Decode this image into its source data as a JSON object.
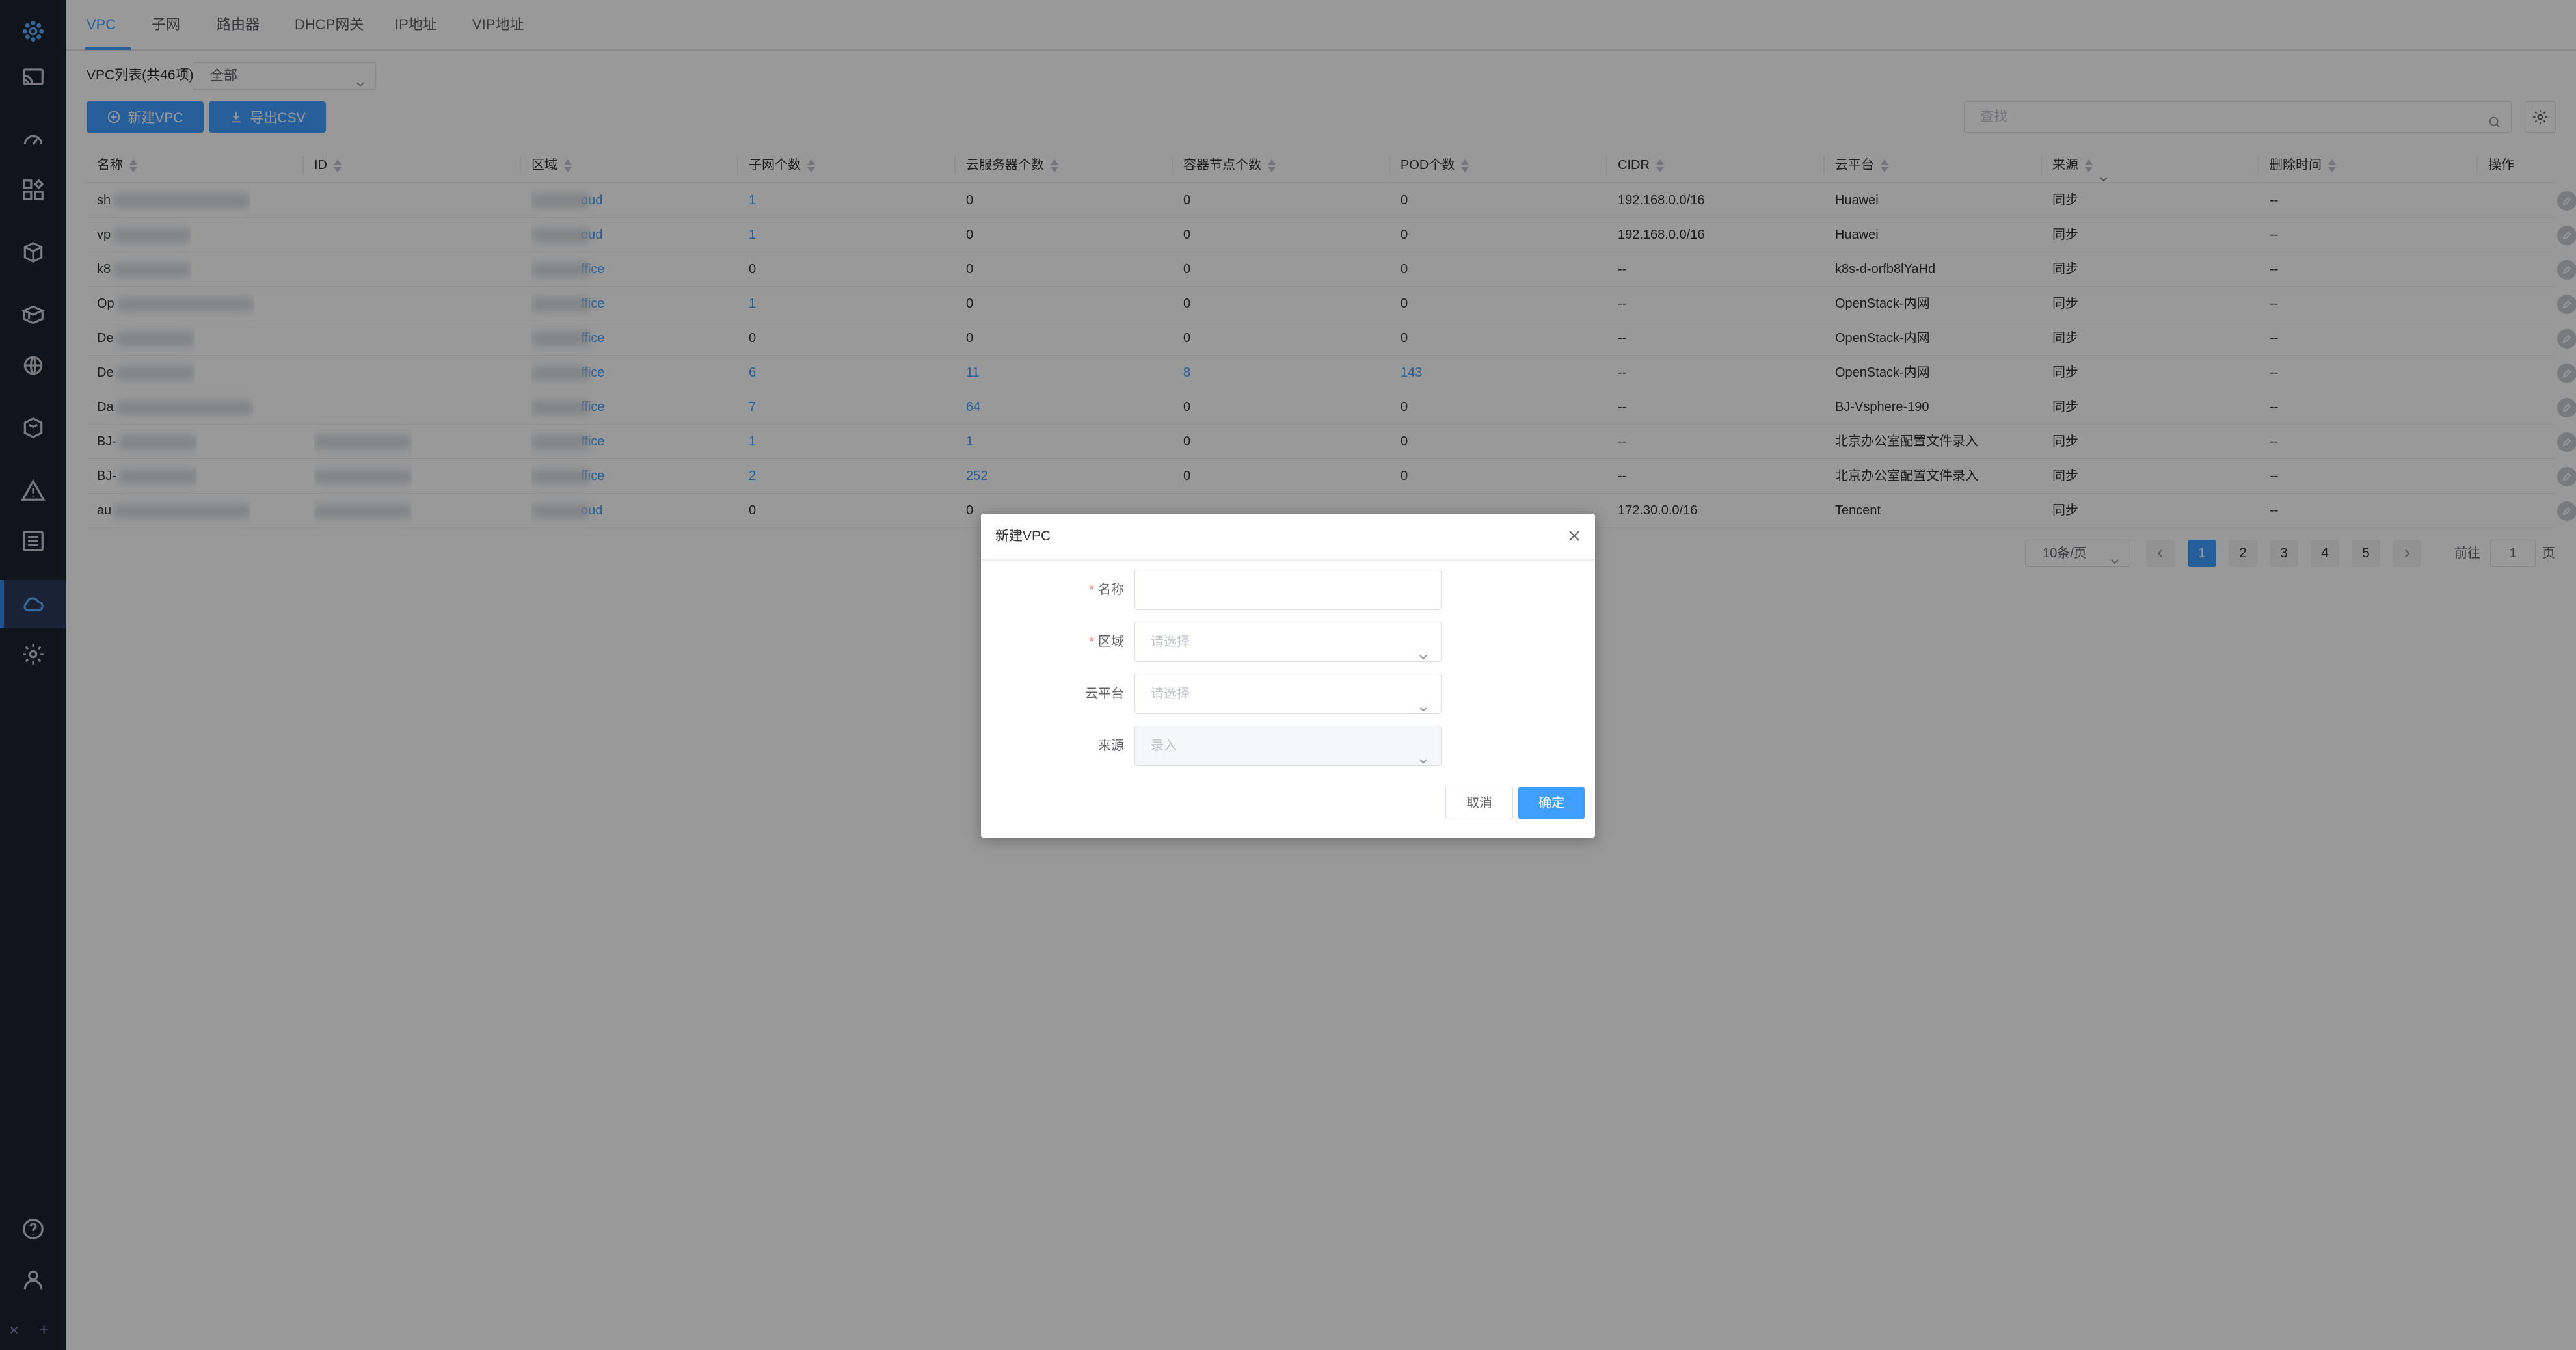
{
  "tabs": [
    "VPC",
    "子网",
    "路由器",
    "DHCP网关",
    "IP地址",
    "VIP地址"
  ],
  "filter": {
    "label": "VPC列表(共46项)",
    "value": "全部"
  },
  "toolbar": {
    "new_label": "新建VPC",
    "export_label": "导出CSV",
    "search_placeholder": "查找"
  },
  "table": {
    "headers": [
      "名称",
      "ID",
      "区域",
      "子网个数",
      "云服务器个数",
      "容器节点个数",
      "POD个数",
      "CIDR",
      "云平台",
      "来源",
      "删除时间",
      "操作"
    ],
    "rows": [
      {
        "name": "sh",
        "region": "oud",
        "subnets": "1",
        "servers": "0",
        "nodes": "0",
        "pods": "0",
        "cidr": "192.168.0.0/16",
        "platform": "Huawei",
        "source": "同步",
        "deleted": "--"
      },
      {
        "name": "vp",
        "region": "oud",
        "subnets": "1",
        "servers": "0",
        "nodes": "0",
        "pods": "0",
        "cidr": "192.168.0.0/16",
        "platform": "Huawei",
        "source": "同步",
        "deleted": "--"
      },
      {
        "name": "k8",
        "region": "ffice",
        "subnets": "0",
        "servers": "0",
        "nodes": "0",
        "pods": "0",
        "cidr": "--",
        "platform": "k8s-d-orfb8lYaHd",
        "source": "同步",
        "deleted": "--"
      },
      {
        "name": "Op",
        "region": "ffice",
        "subnets": "1",
        "servers": "0",
        "nodes": "0",
        "pods": "0",
        "cidr": "--",
        "platform": "OpenStack-内网",
        "source": "同步",
        "deleted": "--"
      },
      {
        "name": "De",
        "region": "ffice",
        "subnets": "0",
        "servers": "0",
        "nodes": "0",
        "pods": "0",
        "cidr": "--",
        "platform": "OpenStack-内网",
        "source": "同步",
        "deleted": "--"
      },
      {
        "name": "De",
        "region": "ffice",
        "subnets": "6",
        "servers": "11",
        "nodes": "8",
        "pods": "143",
        "cidr": "--",
        "platform": "OpenStack-内网",
        "source": "同步",
        "deleted": "--"
      },
      {
        "name": "Da",
        "region": "ffice",
        "subnets": "7",
        "servers": "64",
        "nodes": "0",
        "pods": "0",
        "cidr": "--",
        "platform": "BJ-Vsphere-190",
        "source": "同步",
        "deleted": "--"
      },
      {
        "name": "BJ-",
        "region": "ffice",
        "subnets": "1",
        "servers": "1",
        "nodes": "0",
        "pods": "0",
        "cidr": "--",
        "platform": "北京办公室配置文件录入",
        "source": "同步",
        "deleted": "--"
      },
      {
        "name": "BJ-",
        "region": "ffice",
        "subnets": "2",
        "servers": "252",
        "nodes": "0",
        "pods": "0",
        "cidr": "--",
        "platform": "北京办公室配置文件录入",
        "source": "同步",
        "deleted": "--"
      },
      {
        "name": "au",
        "region": "oud",
        "subnets": "0",
        "servers": "0",
        "nodes": "",
        "pods": "",
        "cidr": "172.30.0.0/16",
        "platform": "Tencent",
        "source": "同步",
        "deleted": "--"
      }
    ]
  },
  "pagination": {
    "page_size": "10条/页",
    "pages": [
      "1",
      "2",
      "3",
      "4",
      "5"
    ],
    "current": "1",
    "goto_label": "前往",
    "goto_value": "1",
    "page_suffix": "页"
  },
  "dialog": {
    "title": "新建VPC",
    "fields": [
      {
        "label": "名称",
        "required": true,
        "placeholder": ""
      },
      {
        "label": "区域",
        "required": true,
        "placeholder": "请选择"
      },
      {
        "label": "云平台",
        "required": false,
        "placeholder": "请选择"
      },
      {
        "label": "来源",
        "required": false,
        "placeholder": "录入"
      }
    ],
    "cancel": "取消",
    "confirm": "确定"
  },
  "colors": {
    "primary": "#409eff",
    "sidebar": "#1c2230",
    "overlay": "rgba(0,0,0,0.4)"
  }
}
